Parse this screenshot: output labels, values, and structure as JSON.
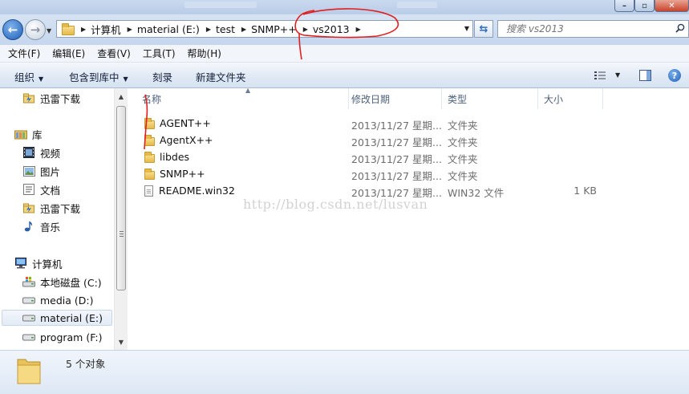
{
  "address_bar": {
    "path": [
      "计算机",
      "material (E:)",
      "test",
      "SNMP++",
      "vs2013"
    ],
    "search_placeholder": "搜索 vs2013"
  },
  "menu": [
    "文件(F)",
    "编辑(E)",
    "查看(V)",
    "工具(T)",
    "帮助(H)"
  ],
  "toolbar": {
    "organize": "组织",
    "include_in_library": "包含到库中",
    "burn": "刻录",
    "new_folder": "新建文件夹"
  },
  "nav": {
    "items": [
      {
        "label": "迅雷下载",
        "icon": "thunder-download-icon"
      },
      {
        "label": "库",
        "icon": "library-icon"
      },
      {
        "label": "视频",
        "icon": "video-icon"
      },
      {
        "label": "图片",
        "icon": "picture-icon"
      },
      {
        "label": "文档",
        "icon": "document-icon"
      },
      {
        "label": "迅雷下载",
        "icon": "thunder-download-icon"
      },
      {
        "label": "音乐",
        "icon": "music-icon"
      },
      {
        "label": "计算机",
        "icon": "computer-icon"
      },
      {
        "label": "本地磁盘 (C:)",
        "icon": "system-drive-icon"
      },
      {
        "label": "media (D:)",
        "icon": "drive-icon"
      },
      {
        "label": "material (E:)",
        "icon": "drive-icon",
        "selected": true
      },
      {
        "label": "program (F:)",
        "icon": "drive-icon"
      }
    ]
  },
  "columns": {
    "name": "名称",
    "date": "修改日期",
    "type": "类型",
    "size": "大小"
  },
  "files": [
    {
      "name": "AGENT++",
      "date": "2013/11/27 星期...",
      "type": "文件夹",
      "size": "",
      "icon": "folder-icon"
    },
    {
      "name": "AgentX++",
      "date": "2013/11/27 星期...",
      "type": "文件夹",
      "size": "",
      "icon": "folder-icon"
    },
    {
      "name": "libdes",
      "date": "2013/11/27 星期...",
      "type": "文件夹",
      "size": "",
      "icon": "folder-icon"
    },
    {
      "name": "SNMP++",
      "date": "2013/11/27 星期...",
      "type": "文件夹",
      "size": "",
      "icon": "folder-icon"
    },
    {
      "name": "README.win32",
      "date": "2013/11/27 星期...",
      "type": "WIN32 文件",
      "size": "1 KB",
      "icon": "file-icon"
    }
  ],
  "watermark": "http://blog.csdn.net/lusvan",
  "status": {
    "item_count": "5 个对象"
  },
  "colors": {
    "annotation": "#e02020",
    "toolbar_text": "#15213a",
    "header_text": "#4c607a"
  }
}
